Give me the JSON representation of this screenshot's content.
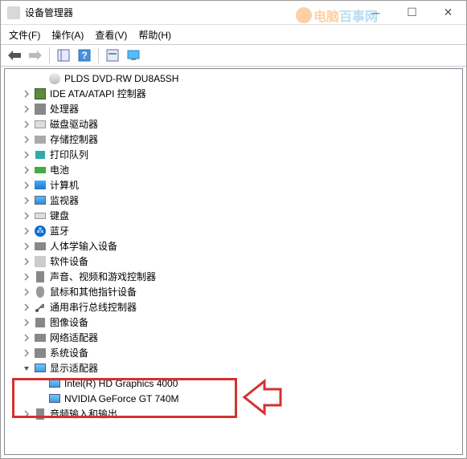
{
  "titlebar": {
    "title": "设备管理器"
  },
  "menubar": {
    "file": "文件(F)",
    "action": "操作(A)",
    "view": "查看(V)",
    "help": "帮助(H)"
  },
  "watermark": {
    "text1": "电脑",
    "text2": "百事网"
  },
  "tree": [
    {
      "icon": "disc",
      "label": "PLDS DVD-RW DU8A5SH",
      "arrow": "none",
      "child": true
    },
    {
      "icon": "chip",
      "label": "IDE ATA/ATAPI 控制器",
      "arrow": "collapsed"
    },
    {
      "icon": "cpu",
      "label": "处理器",
      "arrow": "collapsed"
    },
    {
      "icon": "storage",
      "label": "磁盘驱动器",
      "arrow": "collapsed"
    },
    {
      "icon": "disk",
      "label": "存储控制器",
      "arrow": "collapsed"
    },
    {
      "icon": "printer",
      "label": "打印队列",
      "arrow": "collapsed"
    },
    {
      "icon": "battery",
      "label": "电池",
      "arrow": "collapsed"
    },
    {
      "icon": "computer",
      "label": "计算机",
      "arrow": "collapsed"
    },
    {
      "icon": "monitor",
      "label": "监视器",
      "arrow": "collapsed"
    },
    {
      "icon": "keyboard",
      "label": "键盘",
      "arrow": "collapsed"
    },
    {
      "icon": "bluetooth",
      "label": "蓝牙",
      "arrow": "collapsed"
    },
    {
      "icon": "hid",
      "label": "人体学输入设备",
      "arrow": "collapsed"
    },
    {
      "icon": "software",
      "label": "软件设备",
      "arrow": "collapsed"
    },
    {
      "icon": "sound",
      "label": "声音、视频和游戏控制器",
      "arrow": "collapsed"
    },
    {
      "icon": "mouse",
      "label": "鼠标和其他指针设备",
      "arrow": "collapsed"
    },
    {
      "icon": "usb",
      "label": "通用串行总线控制器",
      "arrow": "collapsed"
    },
    {
      "icon": "imaging",
      "label": "图像设备",
      "arrow": "collapsed"
    },
    {
      "icon": "network",
      "label": "网络适配器",
      "arrow": "collapsed"
    },
    {
      "icon": "system",
      "label": "系统设备",
      "arrow": "collapsed"
    },
    {
      "icon": "display",
      "label": "显示适配器",
      "arrow": "expanded"
    },
    {
      "icon": "display",
      "label": "Intel(R) HD Graphics 4000",
      "arrow": "none",
      "child": true
    },
    {
      "icon": "display",
      "label": "NVIDIA GeForce GT 740M",
      "arrow": "none",
      "child": true
    },
    {
      "icon": "audio",
      "label": "音频输入和输出",
      "arrow": "collapsed"
    }
  ]
}
